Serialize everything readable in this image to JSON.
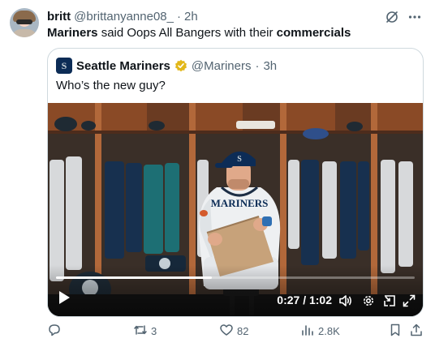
{
  "tweet": {
    "display_name": "britt",
    "handle": "@brittanyanne08_",
    "separator": "·",
    "time": "2h",
    "text_parts": [
      "Mariners",
      " said Oops All Bangers with their ",
      "commercials"
    ]
  },
  "quoted": {
    "display_name": "Seattle Mariners",
    "handle": "@Mariners",
    "separator": "·",
    "time": "3h",
    "text": "Who’s the new guy?",
    "verified_badge": "gold-checkmark-icon"
  },
  "video": {
    "current_time": "0:27",
    "duration": "1:02",
    "time_display": "0:27 / 1:02",
    "progress_fraction": 0.435,
    "jersey_lettering": "MARINERS"
  },
  "actions": {
    "reply_count": "",
    "retweet_count": "3",
    "like_count": "82",
    "views_count": "2.8K"
  },
  "icons": {
    "top": [
      "grok-icon",
      "more-icon"
    ],
    "video_controls": [
      "play-icon",
      "volume-icon",
      "settings-icon",
      "pip-icon",
      "fullscreen-icon"
    ],
    "actions": [
      "reply-icon",
      "retweet-icon",
      "like-icon",
      "views-icon",
      "bookmark-icon",
      "share-icon"
    ]
  },
  "colors": {
    "text_primary": "#0f1419",
    "text_secondary": "#536471",
    "border": "#cfd9de",
    "mariners_navy": "#0c2c56",
    "mariners_teal": "#005c5c",
    "verified_gold": "#e2b719"
  }
}
